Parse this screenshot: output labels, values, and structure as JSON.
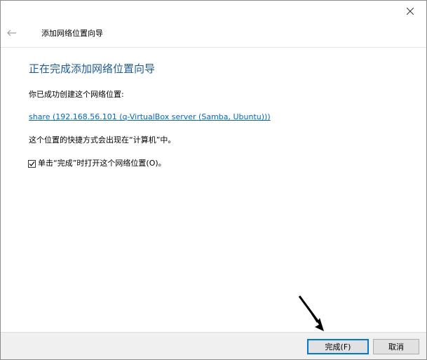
{
  "wizard": {
    "title": "添加网络位置向导",
    "heading": "正在完成添加网络位置向导",
    "success_text": "你已成功创建这个网络位置:",
    "location_link": "share (192.168.56.101 (q-VirtualBox server (Samba, Ubuntu)))",
    "shortcut_text": "这个位置的快捷方式会出现在“计算机”中。",
    "checkbox_label": "单击“完成”时打开这个网络位置(O)。",
    "checkbox_checked": true
  },
  "footer": {
    "finish_label": "完成(F)",
    "cancel_label": "取消"
  },
  "icons": {
    "close": "close-icon",
    "back": "back-arrow-icon",
    "check": "checkmark-icon",
    "cursor": "mouse-cursor-icon"
  },
  "colors": {
    "heading": "#1c5b9e",
    "link": "#0066cc",
    "default_button_border": "#0078d7",
    "footer_bg": "#f0f0f0"
  }
}
